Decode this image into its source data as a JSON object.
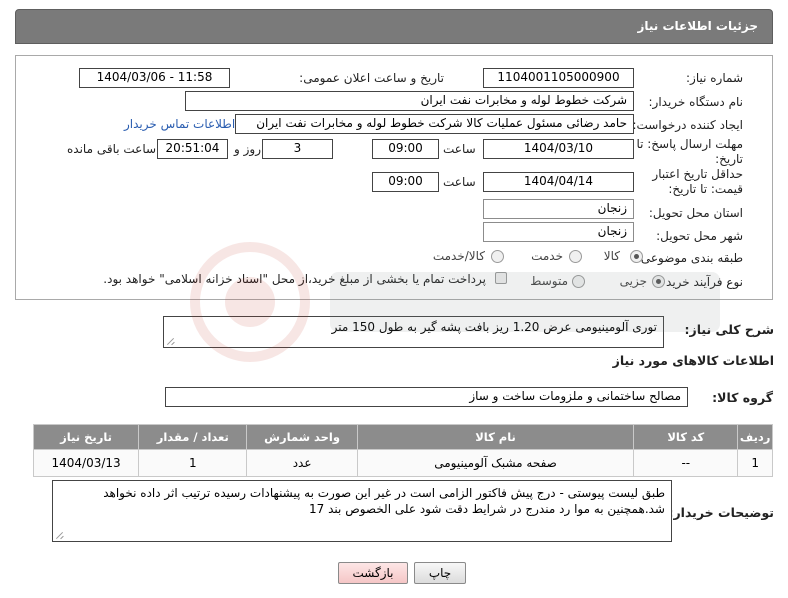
{
  "header": {
    "title": "جزئیات اطلاعات نیاز"
  },
  "form": {
    "need_number": {
      "label": "شماره نیاز:",
      "value": "1104001105000900"
    },
    "announce_datetime": {
      "label": "تاریخ و ساعت اعلان عمومی:",
      "value": "1404/03/06 - 11:58"
    },
    "buyer_org": {
      "label": "نام دستگاه خریدار:",
      "value": "شرکت خطوط لوله و مخابرات نفت ایران"
    },
    "requester": {
      "label": "ایجاد کننده درخواست:",
      "value": "حامد  رضائی  مسئول عملیات کالا  شرکت خطوط لوله و مخابرات نفت ایران",
      "contact_link": "اطلاعات تماس خریدار"
    },
    "reply_deadline": {
      "label": "مهلت ارسال پاسخ: تا تاریخ:",
      "date": "1404/03/10",
      "time_label": "ساعت",
      "time": "09:00",
      "days": "3",
      "days_label": "روز و",
      "remaining": "20:51:04",
      "remaining_label": "ساعت باقی مانده"
    },
    "price_validity": {
      "label": "حداقل تاریخ اعتبار قیمت: تا تاریخ:",
      "date": "1404/04/14",
      "time_label": "ساعت",
      "time": "09:00"
    },
    "delivery_province": {
      "label": "استان محل تحویل:",
      "value": "زنجان"
    },
    "delivery_city": {
      "label": "شهر محل تحویل:",
      "value": "زنجان"
    },
    "category": {
      "label": "طبقه بندی موضوعی:",
      "options": [
        "کالا",
        "خدمت",
        "کالا/خدمت"
      ],
      "selected": "کالا"
    },
    "purchase_process": {
      "label": "نوع فرآیند خرید :",
      "options": [
        "جزیی",
        "متوسط"
      ],
      "selected": "جزیی",
      "payment_note": "پرداخت تمام یا بخشی از مبلغ خرید،از محل \"اسناد خزانه اسلامی\" خواهد بود."
    }
  },
  "description": {
    "label": "شرح کلی نیاز:",
    "value": "توری آلومینیومی عرض 1.20 ریز بافت پشه گیر به طول 150 متر"
  },
  "goods_section": {
    "title": "اطلاعات کالاهای مورد نیاز",
    "group_label": "گروه کالا:",
    "group_value": "مصالح ساختمانی و ملزومات ساخت و ساز",
    "columns": [
      "ردیف",
      "کد کالا",
      "نام کالا",
      "واحد شمارش",
      "تعداد / مقدار",
      "تاریخ نیاز"
    ],
    "rows": [
      {
        "row": "1",
        "code": "--",
        "name": "صفحه مشبک آلومینیومی",
        "unit": "عدد",
        "qty": "1",
        "date": "1404/03/13"
      }
    ]
  },
  "buyer_notes": {
    "label": "توضیحات خریدار:",
    "value": "طبق لیست پیوستی - درج پیش فاکتور الزامی است در غیر این صورت به پیشنهادات رسیده ترتیب اثر داده نخواهد شد.همچنین به موا رد مندرج در شرایط دقت شود علی الخصوص بند 17"
  },
  "buttons": {
    "print": "چاپ",
    "back": "بازگشت"
  },
  "colors": {
    "header_bg": "#7a7a7a",
    "table_header_bg": "#8c8c8c",
    "link": "#2a5db0",
    "back_button": "#f5c6c6"
  }
}
